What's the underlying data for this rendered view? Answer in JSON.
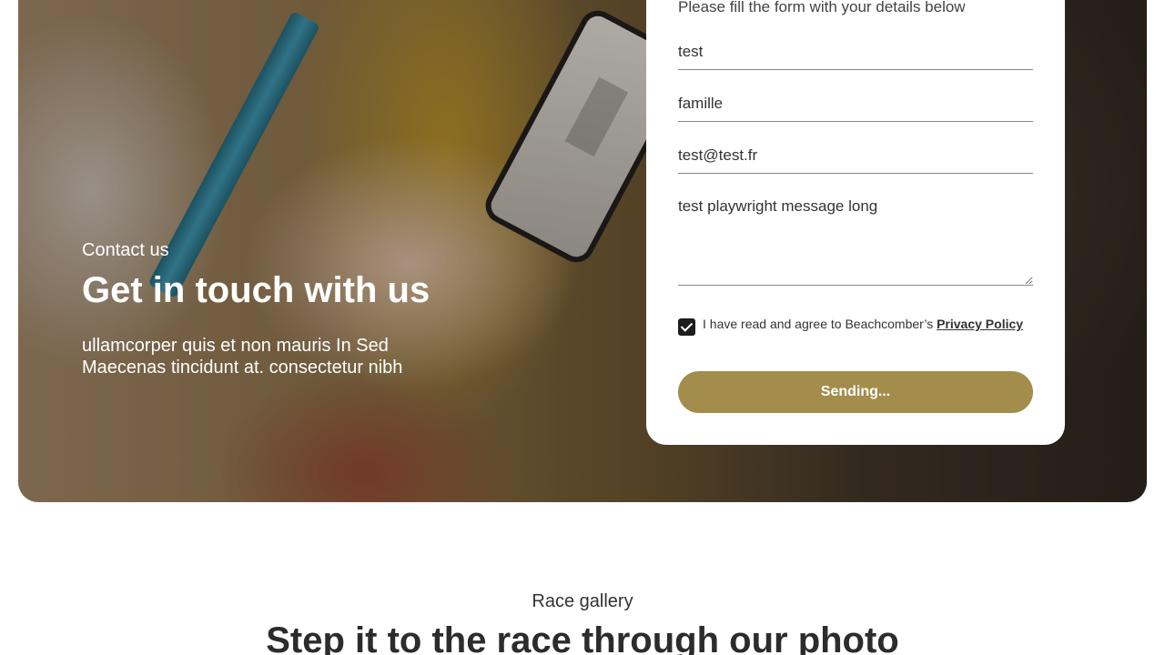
{
  "contact": {
    "eyebrow": "Contact us",
    "title": "Get in touch with us",
    "description": "ullamcorper quis et non mauris In Sed Maecenas tincidunt at. consectetur nibh"
  },
  "form": {
    "intro": "Please fill the form with your details below",
    "first_name_value": "test",
    "last_name_value": "famille",
    "email_value": "test@test.fr",
    "message_value": "test playwright message long",
    "consent_text": "I have read and agree to Beachcomber’s ",
    "consent_link": "Privacy Policy",
    "consent_checked": true,
    "submit_label": "Sending...",
    "accent_color": "#a48d4c"
  },
  "gallery": {
    "eyebrow": "Race gallery",
    "title": "Step it to the race through our photo"
  },
  "icons": {
    "checkbox": "checkmark-icon"
  }
}
